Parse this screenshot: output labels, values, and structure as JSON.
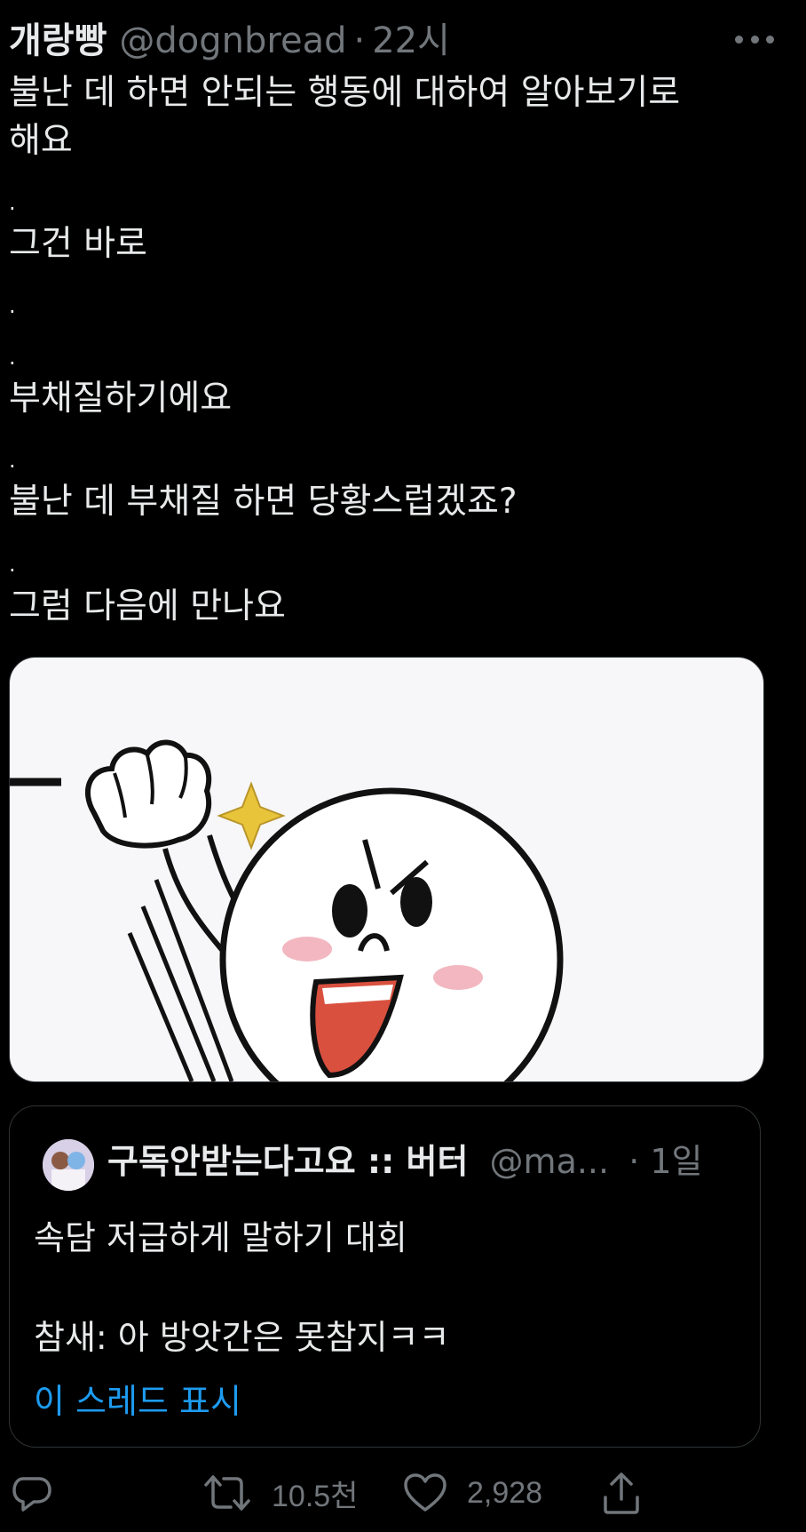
{
  "tweet": {
    "display_name": "개랑빵",
    "handle": "@dognbread",
    "separator": "·",
    "time": "22시",
    "more_icon": "more-horizontal-icon",
    "lines": [
      "불난 데 하면 안되는 행동에 대하여 알아보기로",
      "해요",
      ".",
      "그건 바로",
      ".",
      ".",
      "부채질하기에요",
      ".",
      "불난 데 부채질 하면 당황스럽겠죠?",
      ".",
      "그럼 다음에 만나요"
    ]
  },
  "media": {
    "description_icon": "cartoon-fist-pump-image"
  },
  "quote": {
    "avatar_icon": "avatar-icon",
    "name": "구독안받는다고요 :: 버터",
    "handle": "@ma...",
    "time": "· 1일",
    "lines": [
      "속담 저급하게 말하기 대회",
      "참새: 아 방앗간은 못참지ㅋㅋ"
    ],
    "show_thread": "이 스레드 표시"
  },
  "actions": {
    "reply_icon": "reply-icon",
    "retweet_icon": "retweet-icon",
    "retweet_count": "10.5천",
    "like_icon": "heart-icon",
    "like_count": "2,928",
    "share_icon": "share-icon"
  },
  "colors": {
    "background": "#000000",
    "text": "#e7e9ea",
    "secondary": "#71767b",
    "link": "#1d9bf0",
    "border": "#2f3336"
  }
}
